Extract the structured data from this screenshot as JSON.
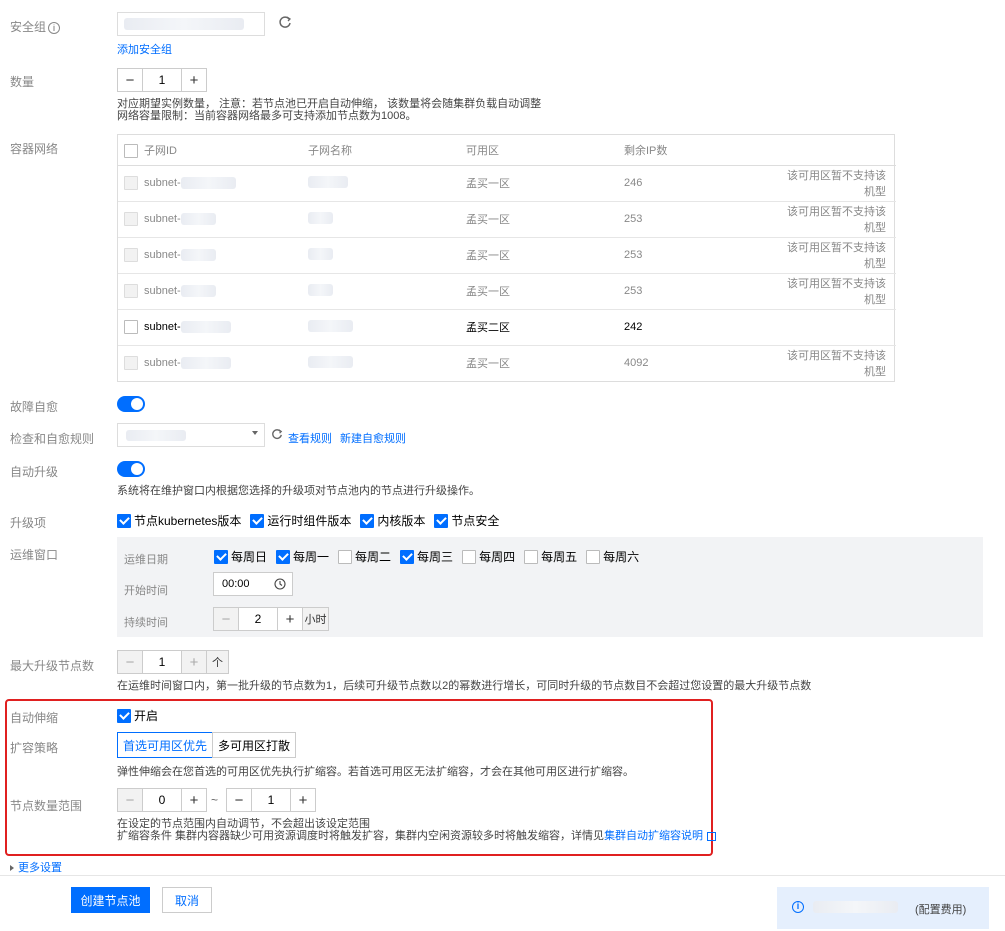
{
  "security_group": {
    "label": "安全组",
    "info_icon": "info-circle-icon",
    "add_link": "添加安全组"
  },
  "quantity": {
    "label": "数量",
    "value": "1",
    "minus": "−",
    "plus": "+",
    "hint1": "对应期望实例数量， 注意：若节点池已开启自动伸缩， 该数量将会随集群负载自动调整",
    "hint2": "网络容量限制：当前容器网络最多可支持添加节点数为1008。"
  },
  "container_network": {
    "label": "容器网络",
    "columns": [
      "子网ID",
      "子网名称",
      "可用区",
      "剩余IP数"
    ],
    "rows": [
      {
        "id": "subnet-",
        "zone": "孟买一区",
        "ips": "246",
        "note": "该可用区暂不支持该机型",
        "active": false
      },
      {
        "id": "subnet-",
        "zone": "孟买一区",
        "ips": "253",
        "note": "该可用区暂不支持该机型",
        "active": false
      },
      {
        "id": "subnet-",
        "zone": "孟买一区",
        "ips": "253",
        "note": "该可用区暂不支持该机型",
        "active": false
      },
      {
        "id": "subnet-",
        "zone": "孟买一区",
        "ips": "253",
        "note": "该可用区暂不支持该机型",
        "active": false
      },
      {
        "id": "subnet-",
        "zone": "孟买二区",
        "ips": "242",
        "note": "",
        "active": true
      },
      {
        "id": "subnet-",
        "zone": "孟买一区",
        "ips": "4092",
        "note": "该可用区暂不支持该机型",
        "active": false
      }
    ]
  },
  "self_heal": {
    "label": "故障自愈",
    "enabled": true
  },
  "heal_rule": {
    "label": "检查和自愈规则",
    "view_link": "查看规则",
    "new_link": "新建自愈规则"
  },
  "auto_upgrade": {
    "label": "自动升级",
    "enabled": true,
    "hint": "系统将在维护窗口内根据您选择的升级项对节点池内的节点进行升级操作。"
  },
  "upgrade_items": {
    "label": "升级项",
    "items": [
      {
        "text": "节点kubernetes版本",
        "checked": true
      },
      {
        "text": "运行时组件版本",
        "checked": true
      },
      {
        "text": "内核版本",
        "checked": true
      },
      {
        "text": "节点安全",
        "checked": true
      }
    ]
  },
  "maint_window": {
    "label": "运维窗口",
    "date_label": "运维日期",
    "days": [
      {
        "text": "每周日",
        "checked": true
      },
      {
        "text": "每周一",
        "checked": true
      },
      {
        "text": "每周二",
        "checked": false
      },
      {
        "text": "每周三",
        "checked": true
      },
      {
        "text": "每周四",
        "checked": false
      },
      {
        "text": "每周五",
        "checked": false
      },
      {
        "text": "每周六",
        "checked": false
      }
    ],
    "start_label": "开始时间",
    "start_value": "00:00",
    "duration_label": "持续时间",
    "duration_value": "2",
    "duration_unit": "小时"
  },
  "max_upgrade": {
    "label": "最大升级节点数",
    "value": "1",
    "unit": "个",
    "hint": "在运维时间窗口内，第一批升级的节点数为1，后续可升级节点数以2的幂数进行增长，可同时升级的节点数目不会超过您设置的最大升级节点数"
  },
  "autoscale": {
    "label": "自动伸缩",
    "enable_text": "开启",
    "enabled": true
  },
  "scale_policy": {
    "label": "扩容策略",
    "options": [
      "首选可用区优先",
      "多可用区打散"
    ],
    "selected": 0,
    "hint": "弹性伸缩会在您首选的可用区优先执行扩缩容。若首选可用区无法扩缩容，才会在其他可用区进行扩缩容。"
  },
  "node_range": {
    "label": "节点数量范围",
    "min": "0",
    "max": "1",
    "sep": "~",
    "hint1": "在设定的节点范围内自动调节，不会超出该设定范围",
    "hint2_prefix": "扩缩容条件 集群内容器缺少可用资源调度时将触发扩容，集群内空闲资源较多时将触发缩容，详情见",
    "hint2_link": "集群自动扩缩容说明"
  },
  "more_settings": "更多设置",
  "footer": {
    "create": "创建节点池",
    "cancel": "取消",
    "cost": "(配置费用)"
  },
  "colors": {
    "primary": "#006eff",
    "highlight_border": "#e02020",
    "panel_bg": "#f2f3f5",
    "cost_bg": "#e5effd"
  }
}
